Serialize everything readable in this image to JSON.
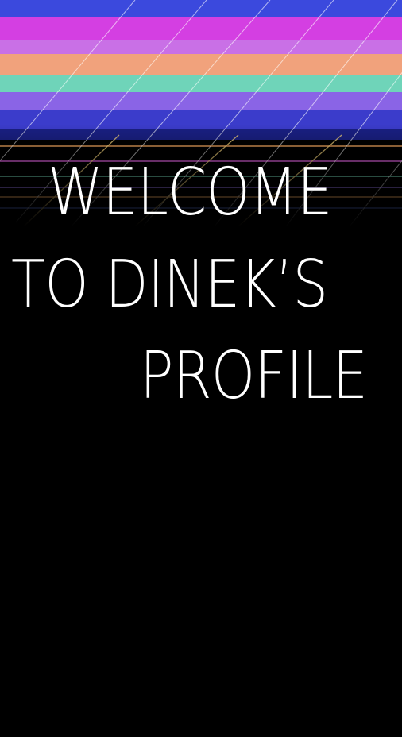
{
  "welcome": {
    "line1": "WELCOME",
    "line2": "TO DINEK’S",
    "line3": "PROFILE"
  },
  "colors": {
    "background": "#000000",
    "text": "#ffffff",
    "bands": [
      "#3b3fd6",
      "#d63fe0",
      "#c86fe8",
      "#f0a27a",
      "#6fd6b8",
      "#8a66e6",
      "#3c3cc8",
      "#1a1f7a"
    ]
  }
}
